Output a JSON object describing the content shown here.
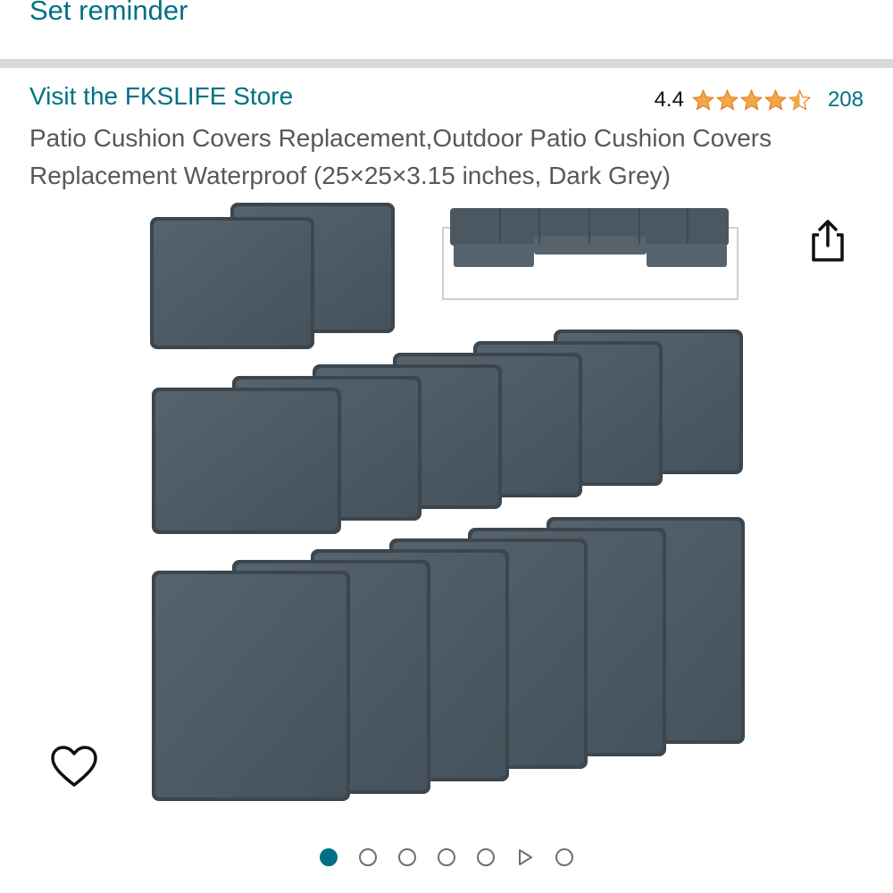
{
  "header": {
    "set_reminder": "Set reminder"
  },
  "product": {
    "store_link": "Visit the FKSLIFE Store",
    "rating_value": "4.4",
    "rating_stars": 4.4,
    "rating_count": "208",
    "title": "Patio Cushion Covers Replacement,Outdoor Patio Cushion Covers Replacement Waterproof (25×25×3.15 inches, Dark Grey)"
  },
  "colors": {
    "link": "#007185",
    "star": "#f3a847",
    "cushion": "#4b5862",
    "cushion_edge": "#3a444c"
  },
  "icons": {
    "share": "share-icon",
    "wishlist": "heart-icon",
    "video": "play-icon"
  },
  "carousel": {
    "total_items": 7,
    "active_index": 0,
    "video_index": 5
  }
}
